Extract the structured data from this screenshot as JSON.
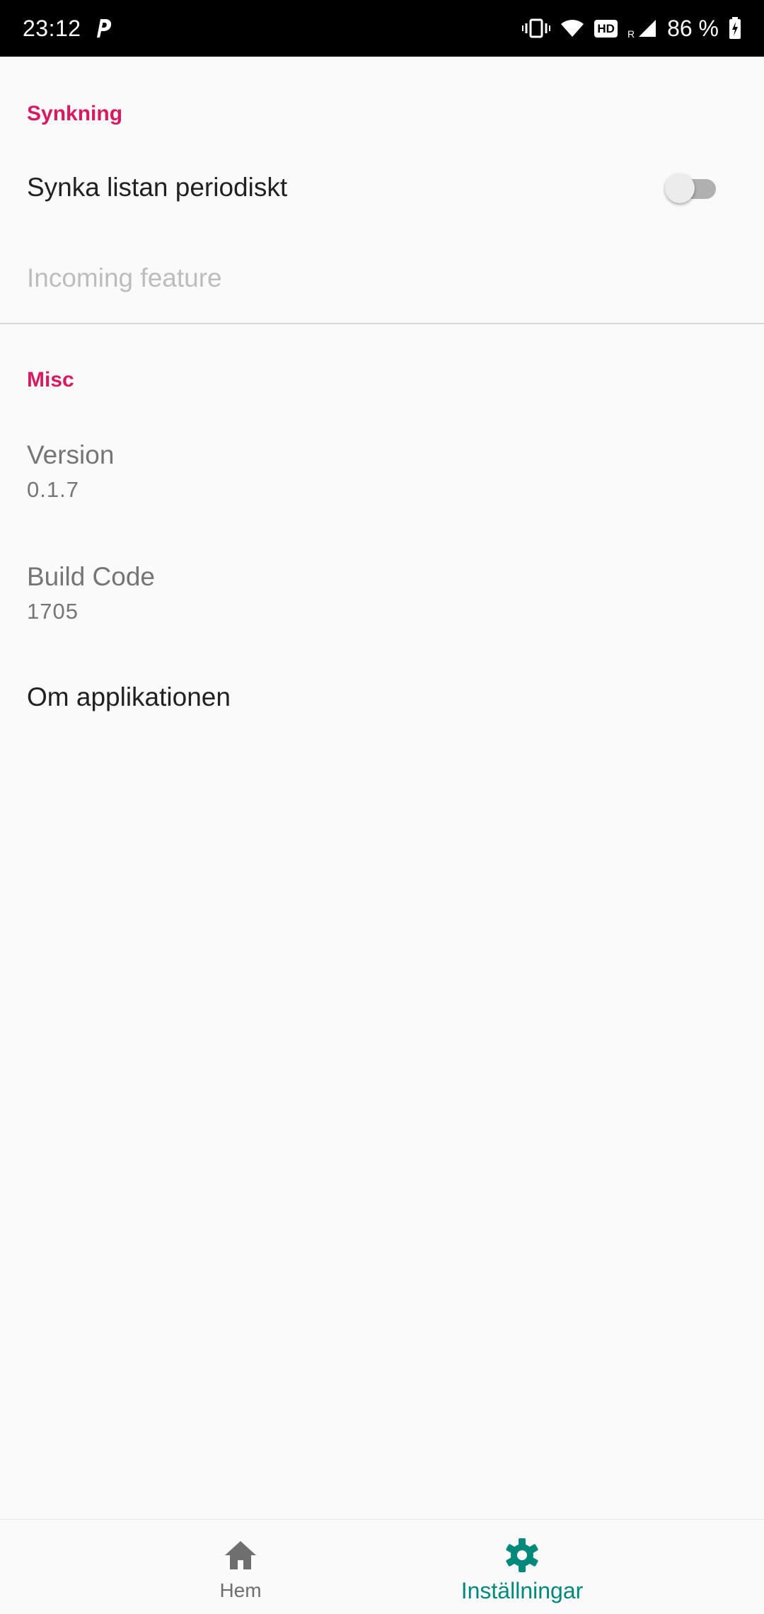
{
  "status_bar": {
    "time": "23:12",
    "app_icon": "p-icon",
    "icons": [
      "vibrate-icon",
      "wifi-icon",
      "hd-icon",
      "signal-icon",
      "battery-charging-icon"
    ],
    "hd_label": "HD",
    "roaming_label": "R",
    "battery": "86 %"
  },
  "settings": {
    "sync_section": {
      "header": "Synkning",
      "sync_periodically": {
        "title": "Synka listan periodiskt",
        "enabled": false
      },
      "incoming_feature": {
        "title": "Incoming feature"
      }
    },
    "misc_section": {
      "header": "Misc",
      "version": {
        "title": "Version",
        "value": "0.1.7"
      },
      "build_code": {
        "title": "Build Code",
        "value": "1705"
      },
      "about": {
        "title": "Om applikationen"
      }
    }
  },
  "bottom_nav": {
    "items": [
      {
        "label": "Hem",
        "icon": "home-icon",
        "active": false
      },
      {
        "label": "Inställningar",
        "icon": "gear-icon",
        "active": true
      }
    ]
  },
  "colors": {
    "accent": "#d81b60",
    "nav_active": "#00897b",
    "nav_inactive": "#6f6f6f"
  }
}
